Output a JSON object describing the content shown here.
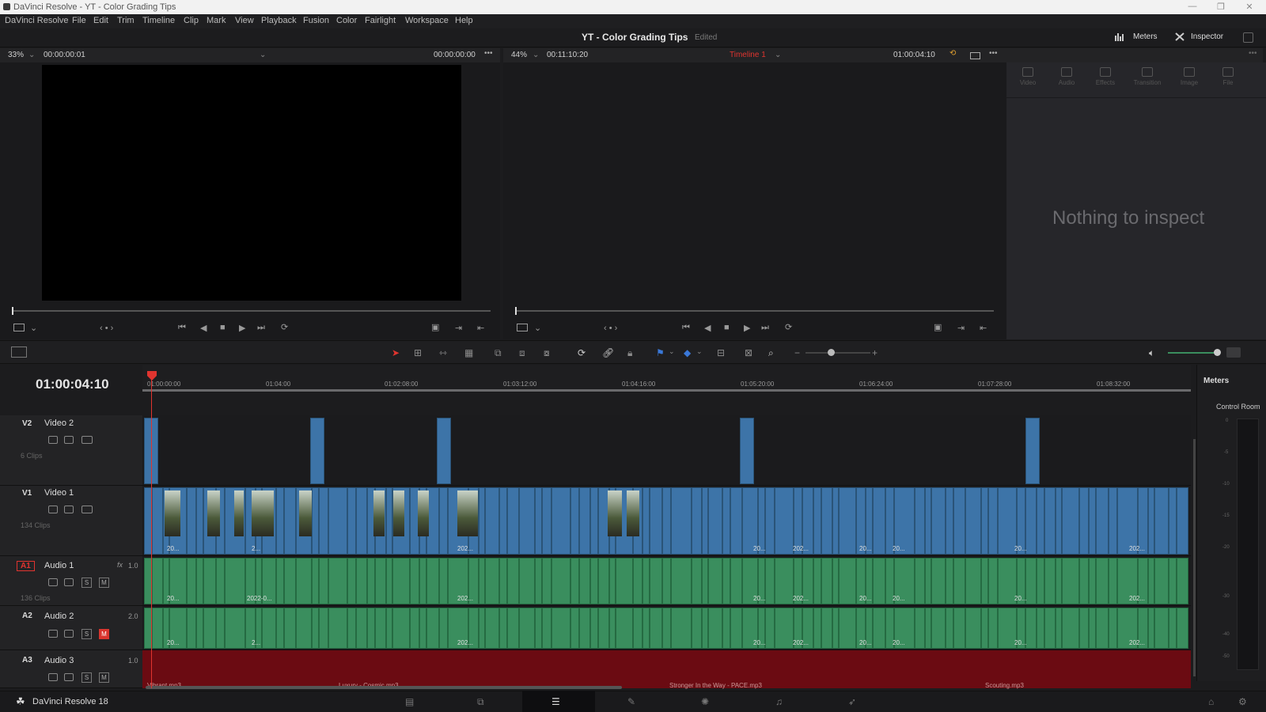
{
  "window": {
    "title": "DaVinci Resolve - YT - Color Grading Tips",
    "controls": [
      "—",
      "❐",
      "✕"
    ]
  },
  "menu": [
    "DaVinci Resolve",
    "File",
    "Edit",
    "Trim",
    "Timeline",
    "Clip",
    "Mark",
    "View",
    "Playback",
    "Fusion",
    "Color",
    "Fairlight",
    "Workspace",
    "Help"
  ],
  "header": {
    "project_title": "YT - Color Grading Tips",
    "project_status": "Edited",
    "meters_label": "Meters",
    "inspector_label": "Inspector"
  },
  "source_viewer": {
    "zoom": "33%",
    "timecode_left": "00:00:00:01",
    "timecode_right": "00:00:00:00"
  },
  "timeline_viewer": {
    "zoom": "44%",
    "duration": "00:11:10:20",
    "timeline_name": "Timeline 1",
    "timecode": "01:00:04:10"
  },
  "inspector": {
    "tabs": [
      "Video",
      "Audio",
      "Effects",
      "Transition",
      "Image",
      "File"
    ],
    "empty_message": "Nothing to inspect"
  },
  "timeline": {
    "current_timecode": "01:00:04:10",
    "ruler_ticks": [
      "01:00:00:00",
      "01:04:00",
      "01:02:08:00",
      "01:03:12:00",
      "01:04:16:00",
      "01:05:20:00",
      "01:06:24:00",
      "01:07:28:00",
      "01:08:32:00"
    ],
    "tracks": {
      "v2": {
        "id": "V2",
        "name": "Video 2",
        "clips": "6 Clips"
      },
      "v1": {
        "id": "V1",
        "name": "Video 1",
        "clips": "134 Clips"
      },
      "a1": {
        "id": "A1",
        "name": "Audio 1",
        "channels": "1.0",
        "fx": "fx",
        "clips": "136 Clips"
      },
      "a2": {
        "id": "A2",
        "name": "Audio 2",
        "channels": "2.0"
      },
      "a3": {
        "id": "A3",
        "name": "Audio 3",
        "channels": "1.0"
      }
    },
    "clip_labels_v1": [
      "20...",
      "2...",
      "202...",
      "20...",
      "202...",
      "20...",
      "20...",
      "20...",
      "202..."
    ],
    "clip_labels_a1": [
      "20...",
      "2022-0...",
      "202...",
      "20...",
      "202...",
      "20...",
      "20...",
      "20...",
      "202..."
    ],
    "clip_labels_a2": [
      "20...",
      "2...",
      "202...",
      "20...",
      "202...",
      "20...",
      "20...",
      "20...",
      "202..."
    ],
    "a3_labels": [
      "Vibrant.mp3",
      "Luxury - Cosmic.mp3",
      "Stronger In the Way - PACE.mp3",
      "Scouting.mp3"
    ]
  },
  "meters_panel": {
    "title": "Meters",
    "subtitle": "Control Room",
    "scale": [
      "0",
      "-5",
      "-10",
      "-15",
      "-20",
      "-30",
      "-40",
      "-50"
    ]
  },
  "bottom": {
    "app_name": "DaVinci Resolve 18"
  },
  "colors": {
    "video_clip": "#3d74a8",
    "audio_clip": "#3a8e5e",
    "audio3_track": "#7a0b12",
    "playhead": "#e0342f",
    "timeline_name": "#e0342f"
  }
}
